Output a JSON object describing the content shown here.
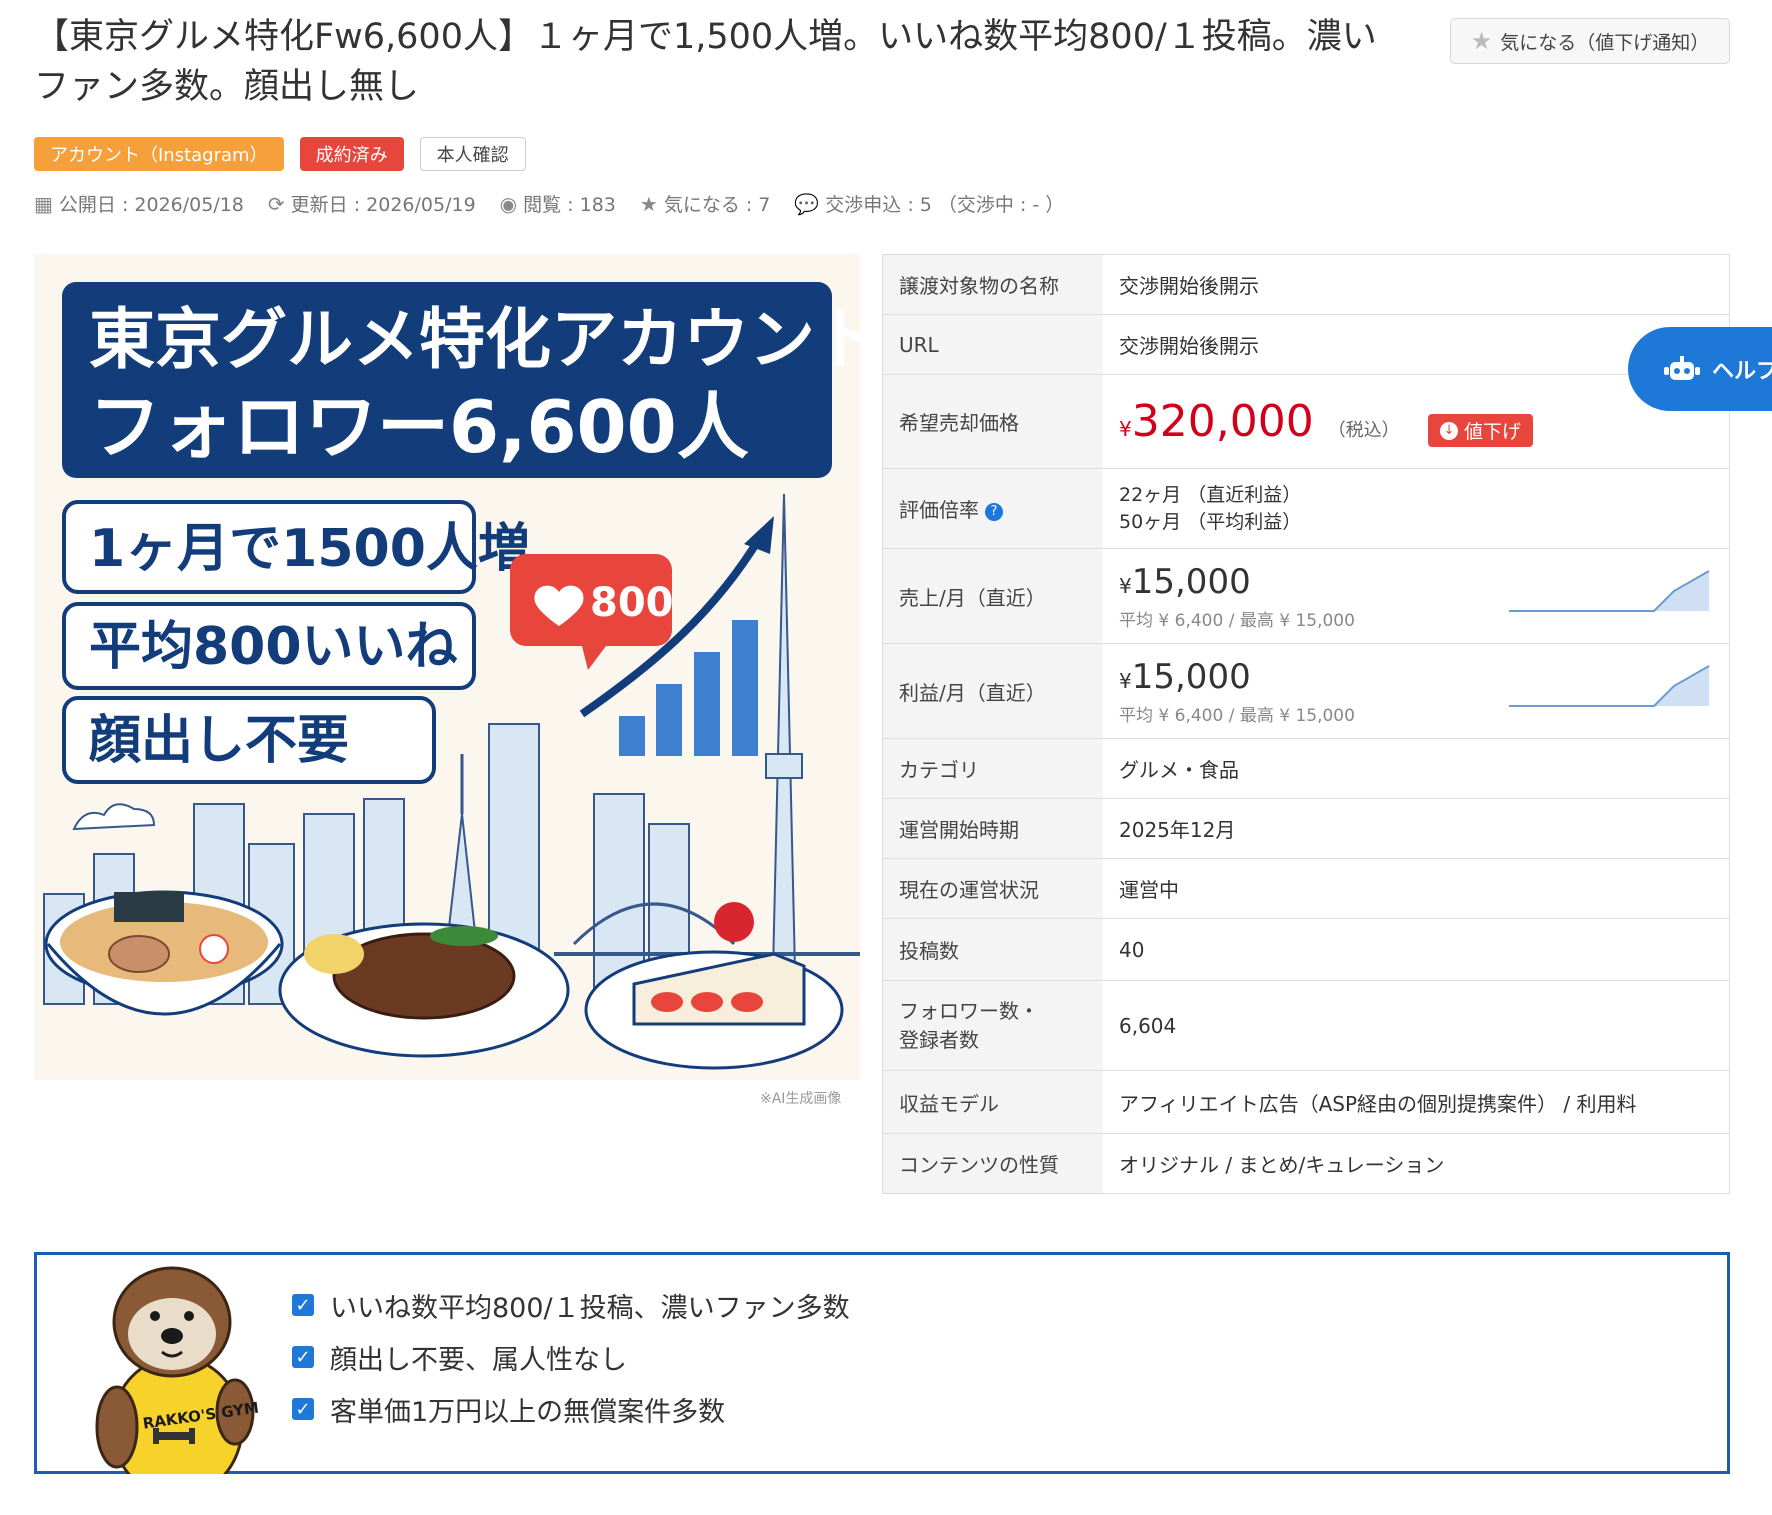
{
  "listing": {
    "title": "【東京グルメ特化Fw6,600人】１ヶ月で1,500人増。いいね数平均800/１投稿。濃いファン多数。顔出し無し",
    "favorite_button": "気になる（値下げ通知）",
    "tags": [
      "アカウント（Instagram）",
      "成約済み",
      "本人確認"
    ],
    "meta": {
      "published": "公開日 : 2026/05/18",
      "updated": "更新日 : 2026/05/19",
      "views": "閲覧 : 183",
      "favorites": "気になる : 7",
      "offers": "交渉申込 : 5 （交渉中 : - ）"
    }
  },
  "hero": {
    "headline1": "東京グルメ特化アカウント",
    "headline2": "フォロワー6,600人",
    "point1": "1ヶ月で1500人増",
    "point2": "平均800いいね",
    "point3": "顔出し不要",
    "likes_badge": "800",
    "ai_note": "※AI生成画像"
  },
  "spec": {
    "rows": [
      {
        "key": "譲渡対象物の名称",
        "value": "交渉開始後開示"
      },
      {
        "key": "URL",
        "value": "交渉開始後開示"
      }
    ],
    "price_label": "希望売却価格",
    "price_yen": "¥",
    "price_value": "320,000",
    "price_tax": "（税込）",
    "price_down": "値下げ",
    "multiple_label": "評価倍率",
    "multiple_line1": "22ヶ月 （直近利益）",
    "multiple_line2": "50ヶ月 （平均利益）",
    "sales_label": "売上/月（直近）",
    "sales_yen": "¥",
    "sales_value": "15,000",
    "sales_sub": "平均 ¥ 6,400 / 最高 ¥ 15,000",
    "profit_label": "利益/月（直近）",
    "profit_yen": "¥",
    "profit_value": "15,000",
    "profit_sub": "平均 ¥ 6,400 / 最高 ¥ 15,000",
    "rows2": [
      {
        "key": "カテゴリ",
        "value": "グルメ・食品"
      },
      {
        "key": "運営開始時期",
        "value": "2025年12月"
      },
      {
        "key": "現在の運営状況",
        "value": "運営中"
      },
      {
        "key": "投稿数",
        "value": "40"
      }
    ],
    "followers_label1": "フォロワー数・",
    "followers_label2": "登録者数",
    "followers_value": "6,604",
    "revenue_model_label": "収益モデル",
    "revenue_model_value": "アフィリエイト広告（ASP経由の個別提携案件） / 利用料",
    "content_label": "コンテンツの性質",
    "content_value": "オリジナル / まとめ/キュレーション"
  },
  "help_button": "ヘルプ",
  "points": [
    "いいね数平均800/１投稿、濃いファン多数",
    "顔出し不要、属人性なし",
    "客単価1万円以上の無償案件多数"
  ],
  "mascot_text": "RAKKO'S GYM",
  "colors": {
    "accent": "#1e78d7",
    "navy": "#0f3a78",
    "price": "#d0021b",
    "orange": "#f5a03a",
    "red": "#e8453c"
  }
}
